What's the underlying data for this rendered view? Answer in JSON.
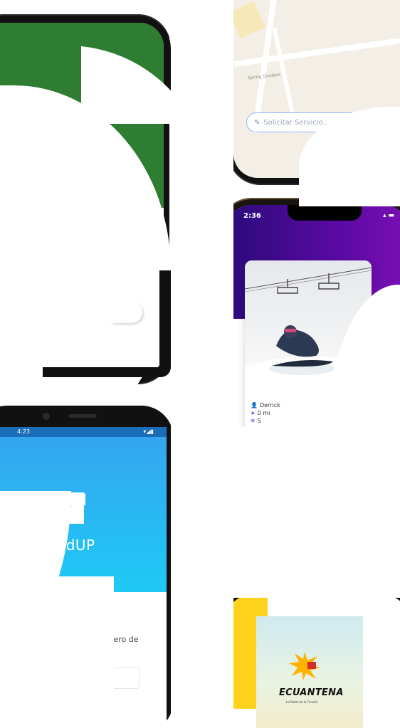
{
  "phone_map": {
    "search_placeholder": "Solicitar Servicio...",
    "street_label": "Spring Gardens"
  },
  "phone_profile": {
    "status_time": "2:36",
    "meta_name": "Derrick",
    "meta_distance": "0 mi",
    "meta_extra": "S"
  },
  "phone_jandup": {
    "status_time": "4:23",
    "brand_name": "JandUP",
    "hint_text": "tu numero de"
  },
  "phone_radio": {
    "station_name": "ECUANTENA",
    "tagline": "La Radio de la Familia"
  },
  "colors": {
    "green": "#2e7d32",
    "purple_start": "#2a0a7a",
    "purple_end": "#7a10b3",
    "blue_start": "#34a6f0",
    "blue_end": "#1ec9f5",
    "radio_yellow": "#ffd31c"
  }
}
